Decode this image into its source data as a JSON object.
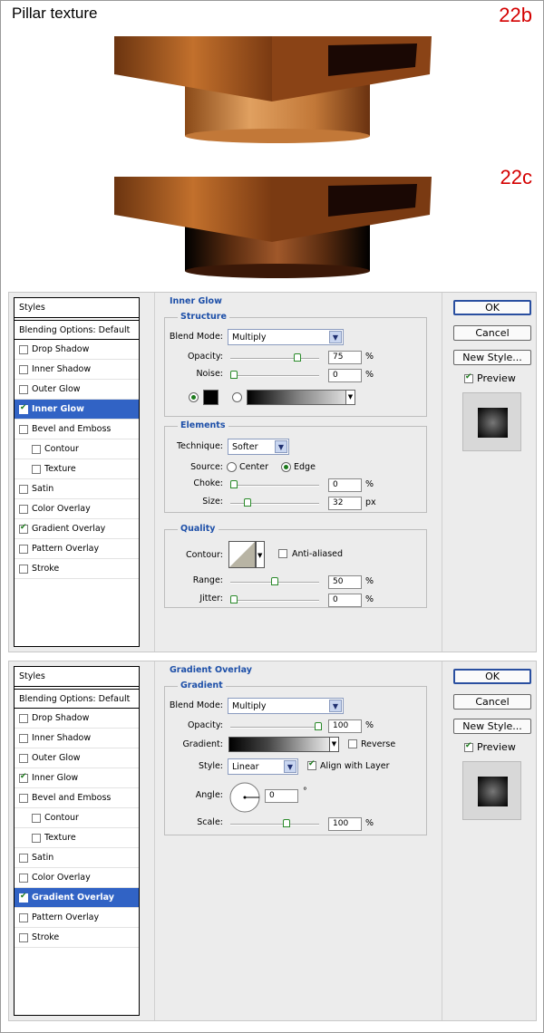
{
  "header": {
    "title": "Pillar texture",
    "step_a": "22b",
    "step_b": "22c"
  },
  "dialog1": {
    "styles_header": "Styles",
    "blending": "Blending Options: Default",
    "items": [
      {
        "label": "Drop Shadow",
        "checked": false
      },
      {
        "label": "Inner Shadow",
        "checked": false
      },
      {
        "label": "Outer Glow",
        "checked": false
      },
      {
        "label": "Inner Glow",
        "checked": true
      },
      {
        "label": "Bevel and Emboss",
        "checked": false
      },
      {
        "label": "Contour",
        "checked": false
      },
      {
        "label": "Texture",
        "checked": false
      },
      {
        "label": "Satin",
        "checked": false
      },
      {
        "label": "Color Overlay",
        "checked": false
      },
      {
        "label": "Gradient Overlay",
        "checked": true
      },
      {
        "label": "Pattern Overlay",
        "checked": false
      },
      {
        "label": "Stroke",
        "checked": false
      }
    ],
    "panel_title": "Inner Glow",
    "structure": {
      "title": "Structure",
      "blend_mode_label": "Blend Mode:",
      "blend_mode": "Multiply",
      "opacity_label": "Opacity:",
      "opacity": "75",
      "opacity_unit": "%",
      "noise_label": "Noise:",
      "noise": "0",
      "noise_unit": "%"
    },
    "elements": {
      "title": "Elements",
      "technique_label": "Technique:",
      "technique": "Softer",
      "source_label": "Source:",
      "center": "Center",
      "edge": "Edge",
      "choke_label": "Choke:",
      "choke": "0",
      "choke_unit": "%",
      "size_label": "Size:",
      "size": "32",
      "size_unit": "px"
    },
    "quality": {
      "title": "Quality",
      "contour_label": "Contour:",
      "anti_aliased": "Anti-aliased",
      "range_label": "Range:",
      "range": "50",
      "range_unit": "%",
      "jitter_label": "Jitter:",
      "jitter": "0",
      "jitter_unit": "%"
    }
  },
  "dialog2": {
    "styles_header": "Styles",
    "blending": "Blending Options: Default",
    "items": [
      {
        "label": "Drop Shadow",
        "checked": false
      },
      {
        "label": "Inner Shadow",
        "checked": false
      },
      {
        "label": "Outer Glow",
        "checked": false
      },
      {
        "label": "Inner Glow",
        "checked": true
      },
      {
        "label": "Bevel and Emboss",
        "checked": false
      },
      {
        "label": "Contour",
        "checked": false
      },
      {
        "label": "Texture",
        "checked": false
      },
      {
        "label": "Satin",
        "checked": false
      },
      {
        "label": "Color Overlay",
        "checked": false
      },
      {
        "label": "Gradient Overlay",
        "checked": true
      },
      {
        "label": "Pattern Overlay",
        "checked": false
      },
      {
        "label": "Stroke",
        "checked": false
      }
    ],
    "panel_title": "Gradient Overlay",
    "gradient": {
      "title": "Gradient",
      "blend_mode_label": "Blend Mode:",
      "blend_mode": "Multiply",
      "opacity_label": "Opacity:",
      "opacity": "100",
      "opacity_unit": "%",
      "gradient_label": "Gradient:",
      "reverse": "Reverse",
      "style_label": "Style:",
      "style": "Linear",
      "align": "Align with Layer",
      "angle_label": "Angle:",
      "angle": "0",
      "angle_unit": "°",
      "scale_label": "Scale:",
      "scale": "100",
      "scale_unit": "%"
    }
  },
  "buttons": {
    "ok": "OK",
    "cancel": "Cancel",
    "new_style": "New Style...",
    "preview": "Preview"
  }
}
